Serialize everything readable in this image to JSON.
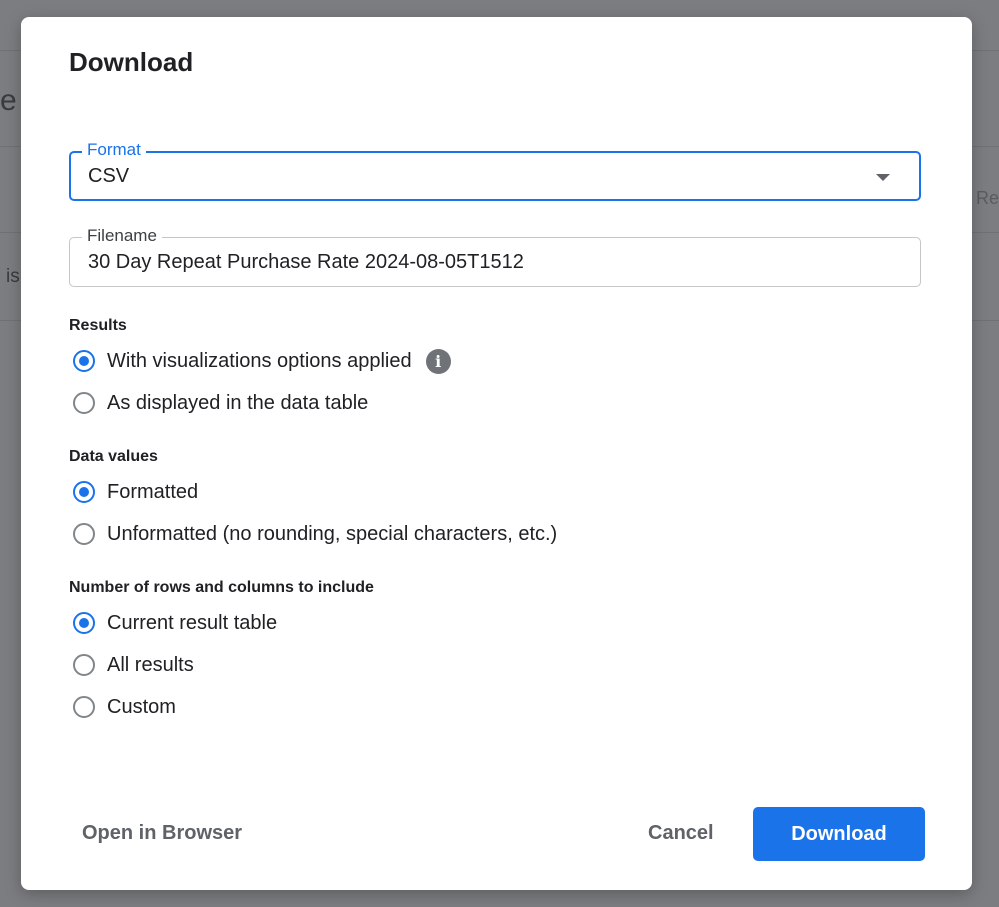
{
  "background": {
    "fragment_left_1": "e",
    "fragment_left_2": "is",
    "fragment_right": "Re"
  },
  "dialog": {
    "title": "Download",
    "format": {
      "label": "Format",
      "value": "CSV"
    },
    "filename": {
      "label": "Filename",
      "value": "30 Day Repeat Purchase Rate 2024-08-05T1512"
    },
    "results": {
      "label": "Results",
      "options": [
        {
          "label": "With visualizations options applied",
          "checked": true
        },
        {
          "label": "As displayed in the data table",
          "checked": false
        }
      ]
    },
    "data_values": {
      "label": "Data values",
      "options": [
        {
          "label": "Formatted",
          "checked": true
        },
        {
          "label": "Unformatted (no rounding, special characters, etc.)",
          "checked": false
        }
      ]
    },
    "rows_columns": {
      "label": "Number of rows and columns to include",
      "options": [
        {
          "label": "Current result table",
          "checked": true
        },
        {
          "label": "All results",
          "checked": false
        },
        {
          "label": "Custom",
          "checked": false
        }
      ]
    },
    "buttons": {
      "open_in_browser": "Open in Browser",
      "cancel": "Cancel",
      "download": "Download"
    },
    "icons": {
      "info": "info-icon",
      "dropdown": "chevron-down-icon"
    },
    "colors": {
      "accent": "#1a73e8"
    }
  }
}
